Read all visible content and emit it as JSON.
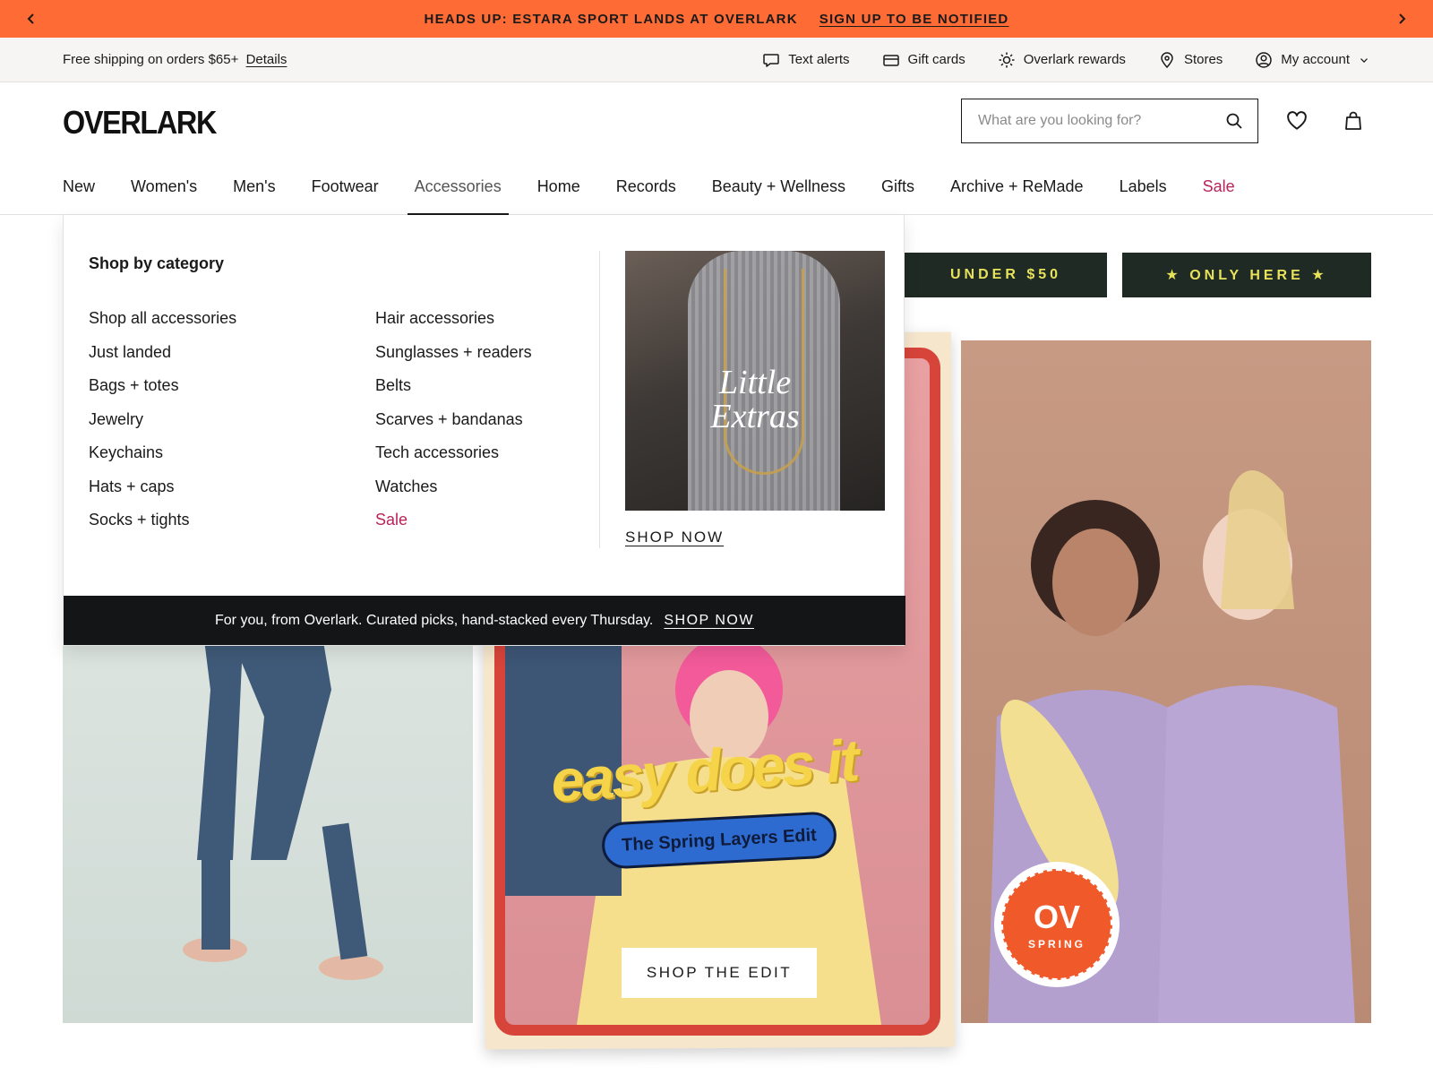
{
  "promo": {
    "message": "HEADS UP: ESTARA SPORT LANDS AT OVERLARK",
    "link": "SIGN UP TO BE NOTIFIED",
    "prev_icon": "chevron-left-icon",
    "next_icon": "chevron-right-icon",
    "bg_color": "#ff6b35"
  },
  "utility": {
    "shipping_text": "Free shipping on orders $65+",
    "shipping_link": "Details",
    "links": [
      {
        "label": "Text alerts",
        "icon": "chat-bubble-icon"
      },
      {
        "label": "Gift cards",
        "icon": "card-icon"
      },
      {
        "label": "Overlark rewards",
        "icon": "sun-icon"
      },
      {
        "label": "Stores",
        "icon": "location-pin-icon"
      },
      {
        "label": "My account",
        "icon": "user-icon"
      }
    ]
  },
  "header": {
    "logo": "OVERLARK",
    "search_placeholder": "What are you looking for?"
  },
  "nav": {
    "items": [
      "New",
      "Women's",
      "Men's",
      "Footwear",
      "Accessories",
      "Home",
      "Records",
      "Beauty + Wellness",
      "Gifts",
      "Archive + ReMade",
      "Labels",
      "Sale"
    ],
    "active": "Accessories",
    "sale_color": "#b8235a"
  },
  "hero": {
    "pill_under": "UNDER $50",
    "pill_only": "★ ONLY HERE ★",
    "easy_text": "easy does it",
    "spring_edit": "The Spring Layers Edit",
    "shop_edit": "SHOP THE EDIT",
    "badge_main": "OV",
    "badge_sub": "SPRING"
  },
  "mega": {
    "title": "Shop by category",
    "col1": [
      "Shop all accessories",
      "Just landed",
      "Bags + totes",
      "Jewelry",
      "Keychains",
      "Hats + caps",
      "Socks + tights"
    ],
    "col2": [
      "Hair accessories",
      "Sunglasses + readers",
      "Belts",
      "Scarves + bandanas",
      "Tech accessories",
      "Watches",
      "Sale"
    ],
    "feature_line1": "Little",
    "feature_line2": "Extras",
    "feature_link": "SHOP NOW",
    "footer_text": "For you, from Overlark. Curated picks, hand-stacked every Thursday.",
    "footer_link": "SHOP NOW"
  }
}
